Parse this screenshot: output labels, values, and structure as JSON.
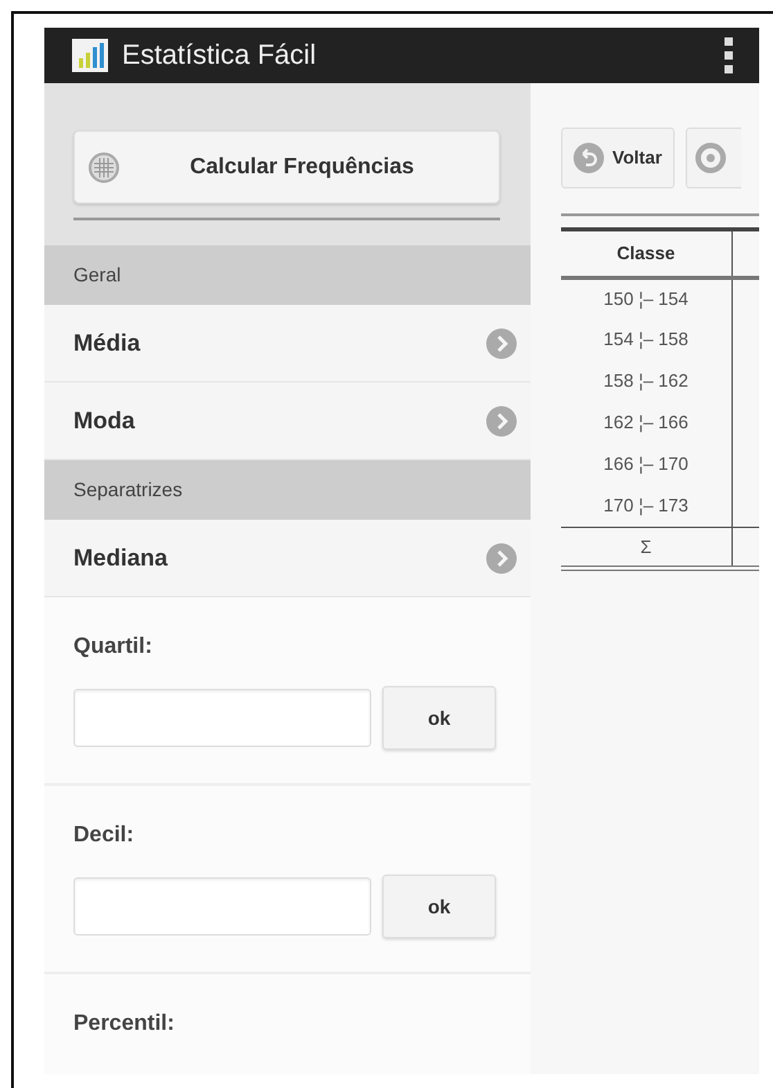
{
  "app_bar": {
    "title": "Estatística Fácil"
  },
  "sidebar": {
    "calc_button": "Calcular Frequências",
    "sections": [
      {
        "header": "Geral",
        "items": [
          {
            "label": "Média"
          },
          {
            "label": "Moda"
          }
        ]
      },
      {
        "header": "Separatrizes",
        "items": [
          {
            "label": "Mediana"
          }
        ]
      }
    ],
    "inputs": [
      {
        "kind": "field",
        "label": "Quartil:",
        "button": "ok"
      },
      {
        "kind": "field",
        "label": "Decil:",
        "button": "ok"
      },
      {
        "kind": "label",
        "label": "Percentil:"
      }
    ]
  },
  "results": {
    "toolbar": [
      {
        "kind": "labeled",
        "label": "Voltar"
      },
      {
        "kind": "cut"
      }
    ],
    "table": {
      "columns": [
        "Classe"
      ],
      "rows": [
        [
          "150 ¦– 154"
        ],
        [
          "154 ¦– 158"
        ],
        [
          "158 ¦– 162"
        ],
        [
          "162 ¦– 166"
        ],
        [
          "166 ¦– 170"
        ],
        [
          "170 ¦– 173"
        ]
      ],
      "footer": [
        "Σ"
      ]
    }
  }
}
